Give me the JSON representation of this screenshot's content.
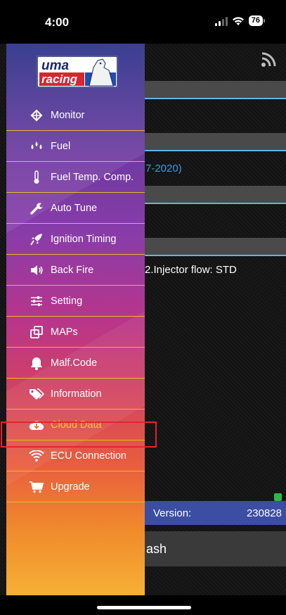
{
  "status_bar": {
    "time": "4:00",
    "battery": "76"
  },
  "background": {
    "year_text": "7-2020)",
    "injector_text": "2.Injector flow: STD",
    "version_label": "Version:",
    "version_value": "230828",
    "flash_label": "ash"
  },
  "drawer": {
    "logo_line1": "uma",
    "logo_line2": "racing",
    "items": [
      {
        "label": "Monitor",
        "icon": "engine-icon"
      },
      {
        "label": "Fuel",
        "icon": "droplets-icon"
      },
      {
        "label": "Fuel Temp. Comp.",
        "icon": "thermometer-icon"
      },
      {
        "label": "Auto Tune",
        "icon": "wrench-icon"
      },
      {
        "label": "Ignition Timing",
        "icon": "rocket-icon"
      },
      {
        "label": "Back Fire",
        "icon": "speaker-icon"
      },
      {
        "label": "Setting",
        "icon": "sliders-icon"
      },
      {
        "label": "MAPs",
        "icon": "copy-icon"
      },
      {
        "label": "Malf.Code",
        "icon": "bell-icon"
      },
      {
        "label": "Information",
        "icon": "tags-icon"
      },
      {
        "label": "Cloud Data",
        "icon": "cloud-download-icon",
        "active": true
      },
      {
        "label": "ECU Connection",
        "icon": "wifi-icon"
      },
      {
        "label": "Upgrade",
        "icon": "cart-icon"
      }
    ]
  },
  "colors": {
    "active": "#f2c52e",
    "divider": "#e7b928",
    "highlight": "#e0262d",
    "accent_line": "#5fb7df",
    "version_bar": "#3b4ea3"
  }
}
